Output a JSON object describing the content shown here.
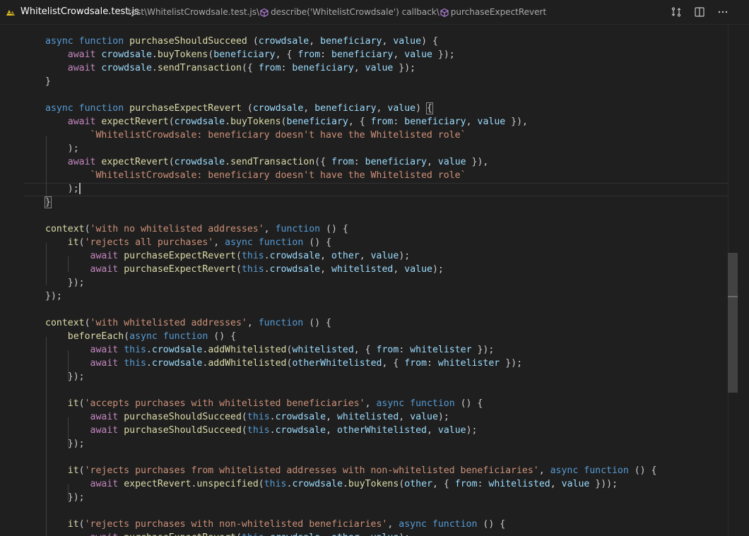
{
  "tab": {
    "file_name": "WhitelistCrowdsale.test.js",
    "breadcrumb_path": "test\\WhitelistCrowdsale.test.js\\",
    "breadcrumb_symbol1": "describe('WhitelistCrowdsale') callback\\",
    "breadcrumb_symbol2": "purchaseExpectRevert",
    "file_icon": "js-file-icon",
    "actions": [
      "compare-changes-icon",
      "split-editor-icon",
      "more-actions-icon"
    ]
  },
  "colors": {
    "background": "#1f1f1f",
    "keyword": "#569cd6",
    "control": "#c586c0",
    "function": "#dcdcaa",
    "variable": "#9cdcfe",
    "string": "#ce9178",
    "punctuation": "#cccccc"
  },
  "code": {
    "lines": [
      [
        [
          "k",
          "async"
        ],
        [
          "p",
          " "
        ],
        [
          "k",
          "function"
        ],
        [
          "p",
          " "
        ],
        [
          "f",
          "purchaseShouldSucceed"
        ],
        [
          "p",
          " ("
        ],
        [
          "v",
          "crowdsale"
        ],
        [
          "p",
          ", "
        ],
        [
          "v",
          "beneficiary"
        ],
        [
          "p",
          ", "
        ],
        [
          "v",
          "value"
        ],
        [
          "p",
          ") {"
        ]
      ],
      [
        [
          "p",
          "    "
        ],
        [
          "c",
          "await"
        ],
        [
          "p",
          " "
        ],
        [
          "v",
          "crowdsale"
        ],
        [
          "p",
          "."
        ],
        [
          "f",
          "buyTokens"
        ],
        [
          "p",
          "("
        ],
        [
          "v",
          "beneficiary"
        ],
        [
          "p",
          ", { "
        ],
        [
          "v",
          "from"
        ],
        [
          "p",
          ": "
        ],
        [
          "v",
          "beneficiary"
        ],
        [
          "p",
          ", "
        ],
        [
          "v",
          "value"
        ],
        [
          "p",
          " });"
        ]
      ],
      [
        [
          "p",
          "    "
        ],
        [
          "c",
          "await"
        ],
        [
          "p",
          " "
        ],
        [
          "v",
          "crowdsale"
        ],
        [
          "p",
          "."
        ],
        [
          "f",
          "sendTransaction"
        ],
        [
          "p",
          "({ "
        ],
        [
          "v",
          "from"
        ],
        [
          "p",
          ": "
        ],
        [
          "v",
          "beneficiary"
        ],
        [
          "p",
          ", "
        ],
        [
          "v",
          "value"
        ],
        [
          "p",
          " });"
        ]
      ],
      [
        [
          "p",
          "}"
        ]
      ],
      [],
      [
        [
          "k",
          "async"
        ],
        [
          "p",
          " "
        ],
        [
          "k",
          "function"
        ],
        [
          "p",
          " "
        ],
        [
          "f",
          "purchaseExpectRevert"
        ],
        [
          "p",
          " ("
        ],
        [
          "v",
          "crowdsale"
        ],
        [
          "p",
          ", "
        ],
        [
          "v",
          "beneficiary"
        ],
        [
          "p",
          ", "
        ],
        [
          "v",
          "value"
        ],
        [
          "p",
          ") "
        ],
        [
          "bm",
          "{"
        ]
      ],
      [
        [
          "p",
          "    "
        ],
        [
          "c",
          "await"
        ],
        [
          "p",
          " "
        ],
        [
          "f",
          "expectRevert"
        ],
        [
          "p",
          "("
        ],
        [
          "v",
          "crowdsale"
        ],
        [
          "p",
          "."
        ],
        [
          "f",
          "buyTokens"
        ],
        [
          "p",
          "("
        ],
        [
          "v",
          "beneficiary"
        ],
        [
          "p",
          ", { "
        ],
        [
          "v",
          "from"
        ],
        [
          "p",
          ": "
        ],
        [
          "v",
          "beneficiary"
        ],
        [
          "p",
          ", "
        ],
        [
          "v",
          "value"
        ],
        [
          "p",
          " }),"
        ]
      ],
      [
        [
          "p",
          "        "
        ],
        [
          "s",
          "`WhitelistCrowdsale: beneficiary doesn't have the Whitelisted role`"
        ]
      ],
      [
        [
          "p",
          "    );"
        ]
      ],
      [
        [
          "p",
          "    "
        ],
        [
          "c",
          "await"
        ],
        [
          "p",
          " "
        ],
        [
          "f",
          "expectRevert"
        ],
        [
          "p",
          "("
        ],
        [
          "v",
          "crowdsale"
        ],
        [
          "p",
          "."
        ],
        [
          "f",
          "sendTransaction"
        ],
        [
          "p",
          "({ "
        ],
        [
          "v",
          "from"
        ],
        [
          "p",
          ": "
        ],
        [
          "v",
          "beneficiary"
        ],
        [
          "p",
          ", "
        ],
        [
          "v",
          "value"
        ],
        [
          "p",
          " }),"
        ]
      ],
      [
        [
          "p",
          "        "
        ],
        [
          "s",
          "`WhitelistCrowdsale: beneficiary doesn't have the Whitelisted role`"
        ]
      ],
      [
        [
          "p",
          "    );"
        ],
        [
          "cur",
          ""
        ]
      ],
      [
        [
          "bm",
          "}"
        ]
      ],
      [],
      [
        [
          "f",
          "context"
        ],
        [
          "p",
          "("
        ],
        [
          "s",
          "'with no whitelisted addresses'"
        ],
        [
          "p",
          ", "
        ],
        [
          "k",
          "function"
        ],
        [
          "p",
          " () {"
        ]
      ],
      [
        [
          "p",
          "    "
        ],
        [
          "f",
          "it"
        ],
        [
          "p",
          "("
        ],
        [
          "s",
          "'rejects all purchases'"
        ],
        [
          "p",
          ", "
        ],
        [
          "k",
          "async"
        ],
        [
          "p",
          " "
        ],
        [
          "k",
          "function"
        ],
        [
          "p",
          " () {"
        ]
      ],
      [
        [
          "p",
          "        "
        ],
        [
          "c",
          "await"
        ],
        [
          "p",
          " "
        ],
        [
          "f",
          "purchaseExpectRevert"
        ],
        [
          "p",
          "("
        ],
        [
          "k",
          "this"
        ],
        [
          "p",
          "."
        ],
        [
          "v",
          "crowdsale"
        ],
        [
          "p",
          ", "
        ],
        [
          "v",
          "other"
        ],
        [
          "p",
          ", "
        ],
        [
          "v",
          "value"
        ],
        [
          "p",
          ");"
        ]
      ],
      [
        [
          "p",
          "        "
        ],
        [
          "c",
          "await"
        ],
        [
          "p",
          " "
        ],
        [
          "f",
          "purchaseExpectRevert"
        ],
        [
          "p",
          "("
        ],
        [
          "k",
          "this"
        ],
        [
          "p",
          "."
        ],
        [
          "v",
          "crowdsale"
        ],
        [
          "p",
          ", "
        ],
        [
          "v",
          "whitelisted"
        ],
        [
          "p",
          ", "
        ],
        [
          "v",
          "value"
        ],
        [
          "p",
          ");"
        ]
      ],
      [
        [
          "p",
          "    });"
        ]
      ],
      [
        [
          "p",
          "});"
        ]
      ],
      [],
      [
        [
          "f",
          "context"
        ],
        [
          "p",
          "("
        ],
        [
          "s",
          "'with whitelisted addresses'"
        ],
        [
          "p",
          ", "
        ],
        [
          "k",
          "function"
        ],
        [
          "p",
          " () {"
        ]
      ],
      [
        [
          "p",
          "    "
        ],
        [
          "f",
          "beforeEach"
        ],
        [
          "p",
          "("
        ],
        [
          "k",
          "async"
        ],
        [
          "p",
          " "
        ],
        [
          "k",
          "function"
        ],
        [
          "p",
          " () {"
        ]
      ],
      [
        [
          "p",
          "        "
        ],
        [
          "c",
          "await"
        ],
        [
          "p",
          " "
        ],
        [
          "k",
          "this"
        ],
        [
          "p",
          "."
        ],
        [
          "v",
          "crowdsale"
        ],
        [
          "p",
          "."
        ],
        [
          "f",
          "addWhitelisted"
        ],
        [
          "p",
          "("
        ],
        [
          "v",
          "whitelisted"
        ],
        [
          "p",
          ", { "
        ],
        [
          "v",
          "from"
        ],
        [
          "p",
          ": "
        ],
        [
          "v",
          "whitelister"
        ],
        [
          "p",
          " });"
        ]
      ],
      [
        [
          "p",
          "        "
        ],
        [
          "c",
          "await"
        ],
        [
          "p",
          " "
        ],
        [
          "k",
          "this"
        ],
        [
          "p",
          "."
        ],
        [
          "v",
          "crowdsale"
        ],
        [
          "p",
          "."
        ],
        [
          "f",
          "addWhitelisted"
        ],
        [
          "p",
          "("
        ],
        [
          "v",
          "otherWhitelisted"
        ],
        [
          "p",
          ", { "
        ],
        [
          "v",
          "from"
        ],
        [
          "p",
          ": "
        ],
        [
          "v",
          "whitelister"
        ],
        [
          "p",
          " });"
        ]
      ],
      [
        [
          "p",
          "    });"
        ]
      ],
      [],
      [
        [
          "p",
          "    "
        ],
        [
          "f",
          "it"
        ],
        [
          "p",
          "("
        ],
        [
          "s",
          "'accepts purchases with whitelisted beneficiaries'"
        ],
        [
          "p",
          ", "
        ],
        [
          "k",
          "async"
        ],
        [
          "p",
          " "
        ],
        [
          "k",
          "function"
        ],
        [
          "p",
          " () {"
        ]
      ],
      [
        [
          "p",
          "        "
        ],
        [
          "c",
          "await"
        ],
        [
          "p",
          " "
        ],
        [
          "f",
          "purchaseShouldSucceed"
        ],
        [
          "p",
          "("
        ],
        [
          "k",
          "this"
        ],
        [
          "p",
          "."
        ],
        [
          "v",
          "crowdsale"
        ],
        [
          "p",
          ", "
        ],
        [
          "v",
          "whitelisted"
        ],
        [
          "p",
          ", "
        ],
        [
          "v",
          "value"
        ],
        [
          "p",
          ");"
        ]
      ],
      [
        [
          "p",
          "        "
        ],
        [
          "c",
          "await"
        ],
        [
          "p",
          " "
        ],
        [
          "f",
          "purchaseShouldSucceed"
        ],
        [
          "p",
          "("
        ],
        [
          "k",
          "this"
        ],
        [
          "p",
          "."
        ],
        [
          "v",
          "crowdsale"
        ],
        [
          "p",
          ", "
        ],
        [
          "v",
          "otherWhitelisted"
        ],
        [
          "p",
          ", "
        ],
        [
          "v",
          "value"
        ],
        [
          "p",
          ");"
        ]
      ],
      [
        [
          "p",
          "    });"
        ]
      ],
      [],
      [
        [
          "p",
          "    "
        ],
        [
          "f",
          "it"
        ],
        [
          "p",
          "("
        ],
        [
          "s",
          "'rejects purchases from whitelisted addresses with non-whitelisted beneficiaries'"
        ],
        [
          "p",
          ", "
        ],
        [
          "k",
          "async"
        ],
        [
          "p",
          " "
        ],
        [
          "k",
          "function"
        ],
        [
          "p",
          " () {"
        ]
      ],
      [
        [
          "p",
          "        "
        ],
        [
          "c",
          "await"
        ],
        [
          "p",
          " "
        ],
        [
          "f",
          "expectRevert"
        ],
        [
          "p",
          "."
        ],
        [
          "f",
          "unspecified"
        ],
        [
          "p",
          "("
        ],
        [
          "k",
          "this"
        ],
        [
          "p",
          "."
        ],
        [
          "v",
          "crowdsale"
        ],
        [
          "p",
          "."
        ],
        [
          "f",
          "buyTokens"
        ],
        [
          "p",
          "("
        ],
        [
          "v",
          "other"
        ],
        [
          "p",
          ", { "
        ],
        [
          "v",
          "from"
        ],
        [
          "p",
          ": "
        ],
        [
          "v",
          "whitelisted"
        ],
        [
          "p",
          ", "
        ],
        [
          "v",
          "value"
        ],
        [
          "p",
          " }));"
        ]
      ],
      [
        [
          "p",
          "    });"
        ]
      ],
      [],
      [
        [
          "p",
          "    "
        ],
        [
          "f",
          "it"
        ],
        [
          "p",
          "("
        ],
        [
          "s",
          "'rejects purchases with non-whitelisted beneficiaries'"
        ],
        [
          "p",
          ", "
        ],
        [
          "k",
          "async"
        ],
        [
          "p",
          " "
        ],
        [
          "k",
          "function"
        ],
        [
          "p",
          " () {"
        ]
      ],
      [
        [
          "p",
          "        "
        ],
        [
          "c",
          "await"
        ],
        [
          "p",
          " "
        ],
        [
          "f",
          "purchaseExpectRevert"
        ],
        [
          "p",
          "("
        ],
        [
          "k",
          "this"
        ],
        [
          "p",
          "."
        ],
        [
          "v",
          "crowdsale"
        ],
        [
          "p",
          ", "
        ],
        [
          "v",
          "other"
        ],
        [
          "p",
          ", "
        ],
        [
          "v",
          "value"
        ],
        [
          "p",
          ");"
        ]
      ]
    ]
  }
}
